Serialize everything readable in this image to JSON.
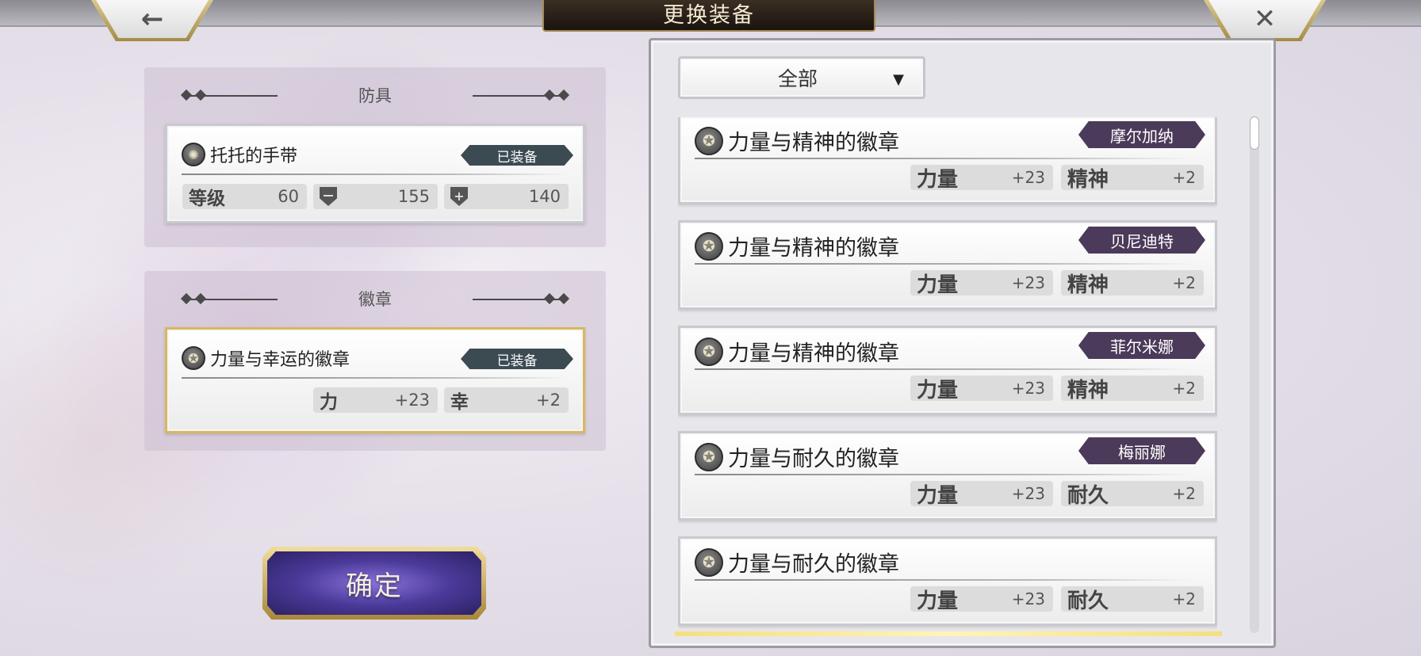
{
  "header": {
    "title": "更换装备",
    "back_icon": "←",
    "close_icon": "✕"
  },
  "left": {
    "armor": {
      "title": "防具",
      "item": {
        "name": "托托的手带",
        "icon": "✺",
        "status": "已装备",
        "stats": [
          {
            "key": "等级",
            "value": "60"
          },
          {
            "key_icon": "shield-icon",
            "value": "155"
          },
          {
            "key_icon": "shield-cross-icon",
            "value": "140"
          }
        ]
      }
    },
    "emblem": {
      "title": "徽章",
      "item": {
        "name": "力量与幸运的徽章",
        "icon": "✪",
        "status": "已装备",
        "stats": [
          {
            "key": "力",
            "value": "+23"
          },
          {
            "key": "幸",
            "value": "+2"
          }
        ]
      }
    },
    "confirm_label": "确定"
  },
  "right": {
    "filter": {
      "selected": "全部",
      "caret": "▼"
    },
    "items": [
      {
        "name": "力量与精神的徽章",
        "owner": "摩尔加纳",
        "stats": [
          {
            "key": "力量",
            "value": "+23"
          },
          {
            "key": "精神",
            "value": "+2"
          }
        ]
      },
      {
        "name": "力量与精神的徽章",
        "owner": "贝尼迪特",
        "stats": [
          {
            "key": "力量",
            "value": "+23"
          },
          {
            "key": "精神",
            "value": "+2"
          }
        ]
      },
      {
        "name": "力量与精神的徽章",
        "owner": "菲尔米娜",
        "stats": [
          {
            "key": "力量",
            "value": "+23"
          },
          {
            "key": "精神",
            "value": "+2"
          }
        ]
      },
      {
        "name": "力量与耐久的徽章",
        "owner": "梅丽娜",
        "stats": [
          {
            "key": "力量",
            "value": "+23"
          },
          {
            "key": "耐久",
            "value": "+2"
          }
        ]
      },
      {
        "name": "力量与耐久的徽章",
        "owner": "",
        "stats": [
          {
            "key": "力量",
            "value": "+23"
          },
          {
            "key": "耐久",
            "value": "+2"
          }
        ]
      }
    ]
  },
  "colors": {
    "equipped_tag": "#3c4a52",
    "owner_tag": "#4c3a5a",
    "confirm_button": "#4b3a9a",
    "gold_border": "#d8b85e"
  }
}
